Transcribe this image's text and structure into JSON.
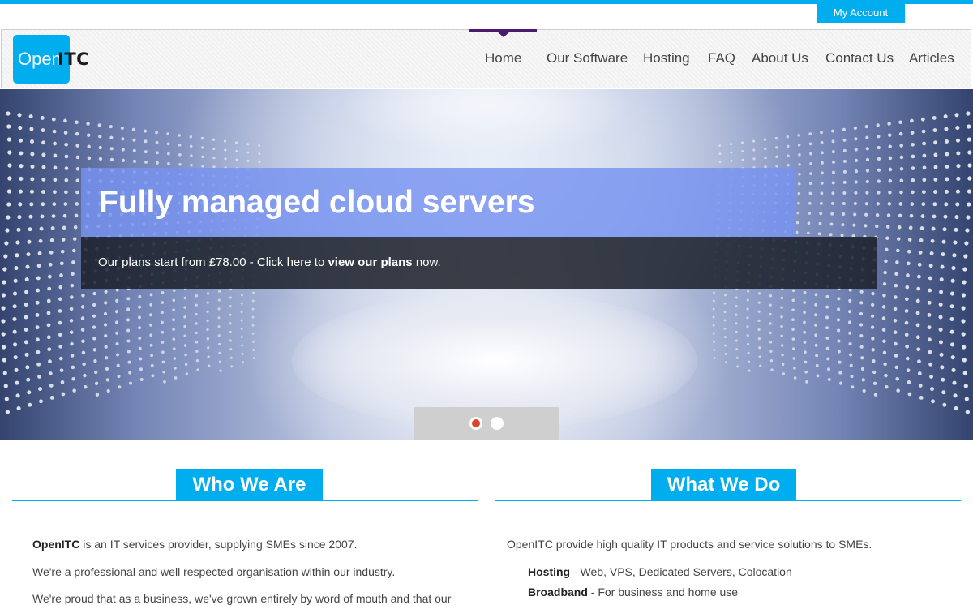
{
  "account": {
    "label": "My Account"
  },
  "logo": {
    "box_text": "Open",
    "tail_text": "ITC"
  },
  "nav": {
    "items": [
      {
        "label": "Home"
      },
      {
        "label": "Our Software"
      },
      {
        "label": "Hosting"
      },
      {
        "label": "FAQ"
      },
      {
        "label": "About Us"
      },
      {
        "label": "Contact Us"
      },
      {
        "label": "Articles"
      }
    ],
    "active": "Home"
  },
  "hero": {
    "title": "Fully managed cloud servers",
    "subtitle_prefix": "Our plans start from £78.00 - Click here to ",
    "subtitle_link": "view our plans",
    "subtitle_suffix": " now.",
    "slides": 2,
    "active_slide": 1
  },
  "who": {
    "heading": "Who We Are",
    "p1_bold": "OpenITC",
    "p1_rest": " is an IT services provider, supplying SMEs since 2007.",
    "p2": "We're a professional and well respected organisation within our industry.",
    "p3": "We're proud that as a business, we've grown entirely by word of mouth and that our"
  },
  "what": {
    "heading": "What We Do",
    "intro": "OpenITC provide high quality IT products and service solutions to SMEs.",
    "items": [
      {
        "name": "Hosting",
        "desc": " - Web, VPS, Dedicated Servers, Colocation"
      },
      {
        "name": "Broadband",
        "desc": " - For business and home use"
      }
    ]
  },
  "colors": {
    "accent": "#00aeef",
    "nav_active": "#4b1a6e",
    "pager_active": "#d9472b"
  }
}
